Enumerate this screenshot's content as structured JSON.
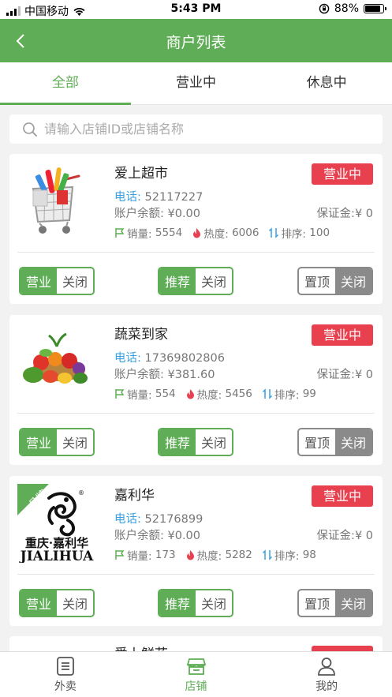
{
  "status_bar": {
    "carrier": "中国移动",
    "time": "5:43 PM",
    "battery": "88%",
    "battery_level": 0.88
  },
  "nav": {
    "title": "商户列表"
  },
  "tabs": [
    {
      "label": "全部",
      "active": true
    },
    {
      "label": "营业中",
      "active": false
    },
    {
      "label": "休息中",
      "active": false
    }
  ],
  "search": {
    "placeholder": "请输入店铺ID或店铺名称"
  },
  "labels": {
    "phone": "电话:",
    "balance": "账户余额:",
    "deposit": "保证金:",
    "sales": "销量:",
    "heat": "热度:",
    "rank": "排序:"
  },
  "stores": [
    {
      "name": "爱上超市",
      "status": "营业中",
      "phone": "52117227",
      "balance": "¥0.00",
      "deposit": "¥ 0",
      "sales": "5554",
      "heat": "6006",
      "rank": "100",
      "toggles": {
        "business": [
          "营业",
          "关闭"
        ],
        "recommend": [
          "推荐",
          "关闭"
        ],
        "pin": [
          "置顶",
          "关闭"
        ]
      }
    },
    {
      "name": "蔬菜到家",
      "status": "营业中",
      "phone": "17369802806",
      "balance": "¥381.60",
      "deposit": "¥ 0",
      "sales": "554",
      "heat": "5456",
      "rank": "99",
      "toggles": {
        "business": [
          "营业",
          "关闭"
        ],
        "recommend": [
          "推荐",
          "关闭"
        ],
        "pin": [
          "置顶",
          "关闭"
        ]
      }
    },
    {
      "name": "嘉利华",
      "status": "营业中",
      "phone": "52176899",
      "balance": "¥0.00",
      "deposit": "¥ 0",
      "sales": "173",
      "heat": "5282",
      "rank": "98",
      "logo": {
        "ribbon": "品牌",
        "line1": "重庆·嘉利华",
        "line2": "JIALIHUA",
        "reg": "®"
      },
      "toggles": {
        "business": [
          "营业",
          "关闭"
        ],
        "recommend": [
          "推荐",
          "关闭"
        ],
        "pin": [
          "置顶",
          "关闭"
        ]
      }
    },
    {
      "name": "爱上鲜花"
    }
  ],
  "tabbar": [
    {
      "label": "外卖",
      "icon": "list-icon",
      "active": false
    },
    {
      "label": "店铺",
      "icon": "store-icon",
      "active": true
    },
    {
      "label": "我的",
      "icon": "user-icon",
      "active": false
    }
  ],
  "colors": {
    "primary": "#5fad56",
    "status_open": "#e8404f",
    "phone_label": "#3aa0e0",
    "pin_gray": "#8a8a8a"
  }
}
